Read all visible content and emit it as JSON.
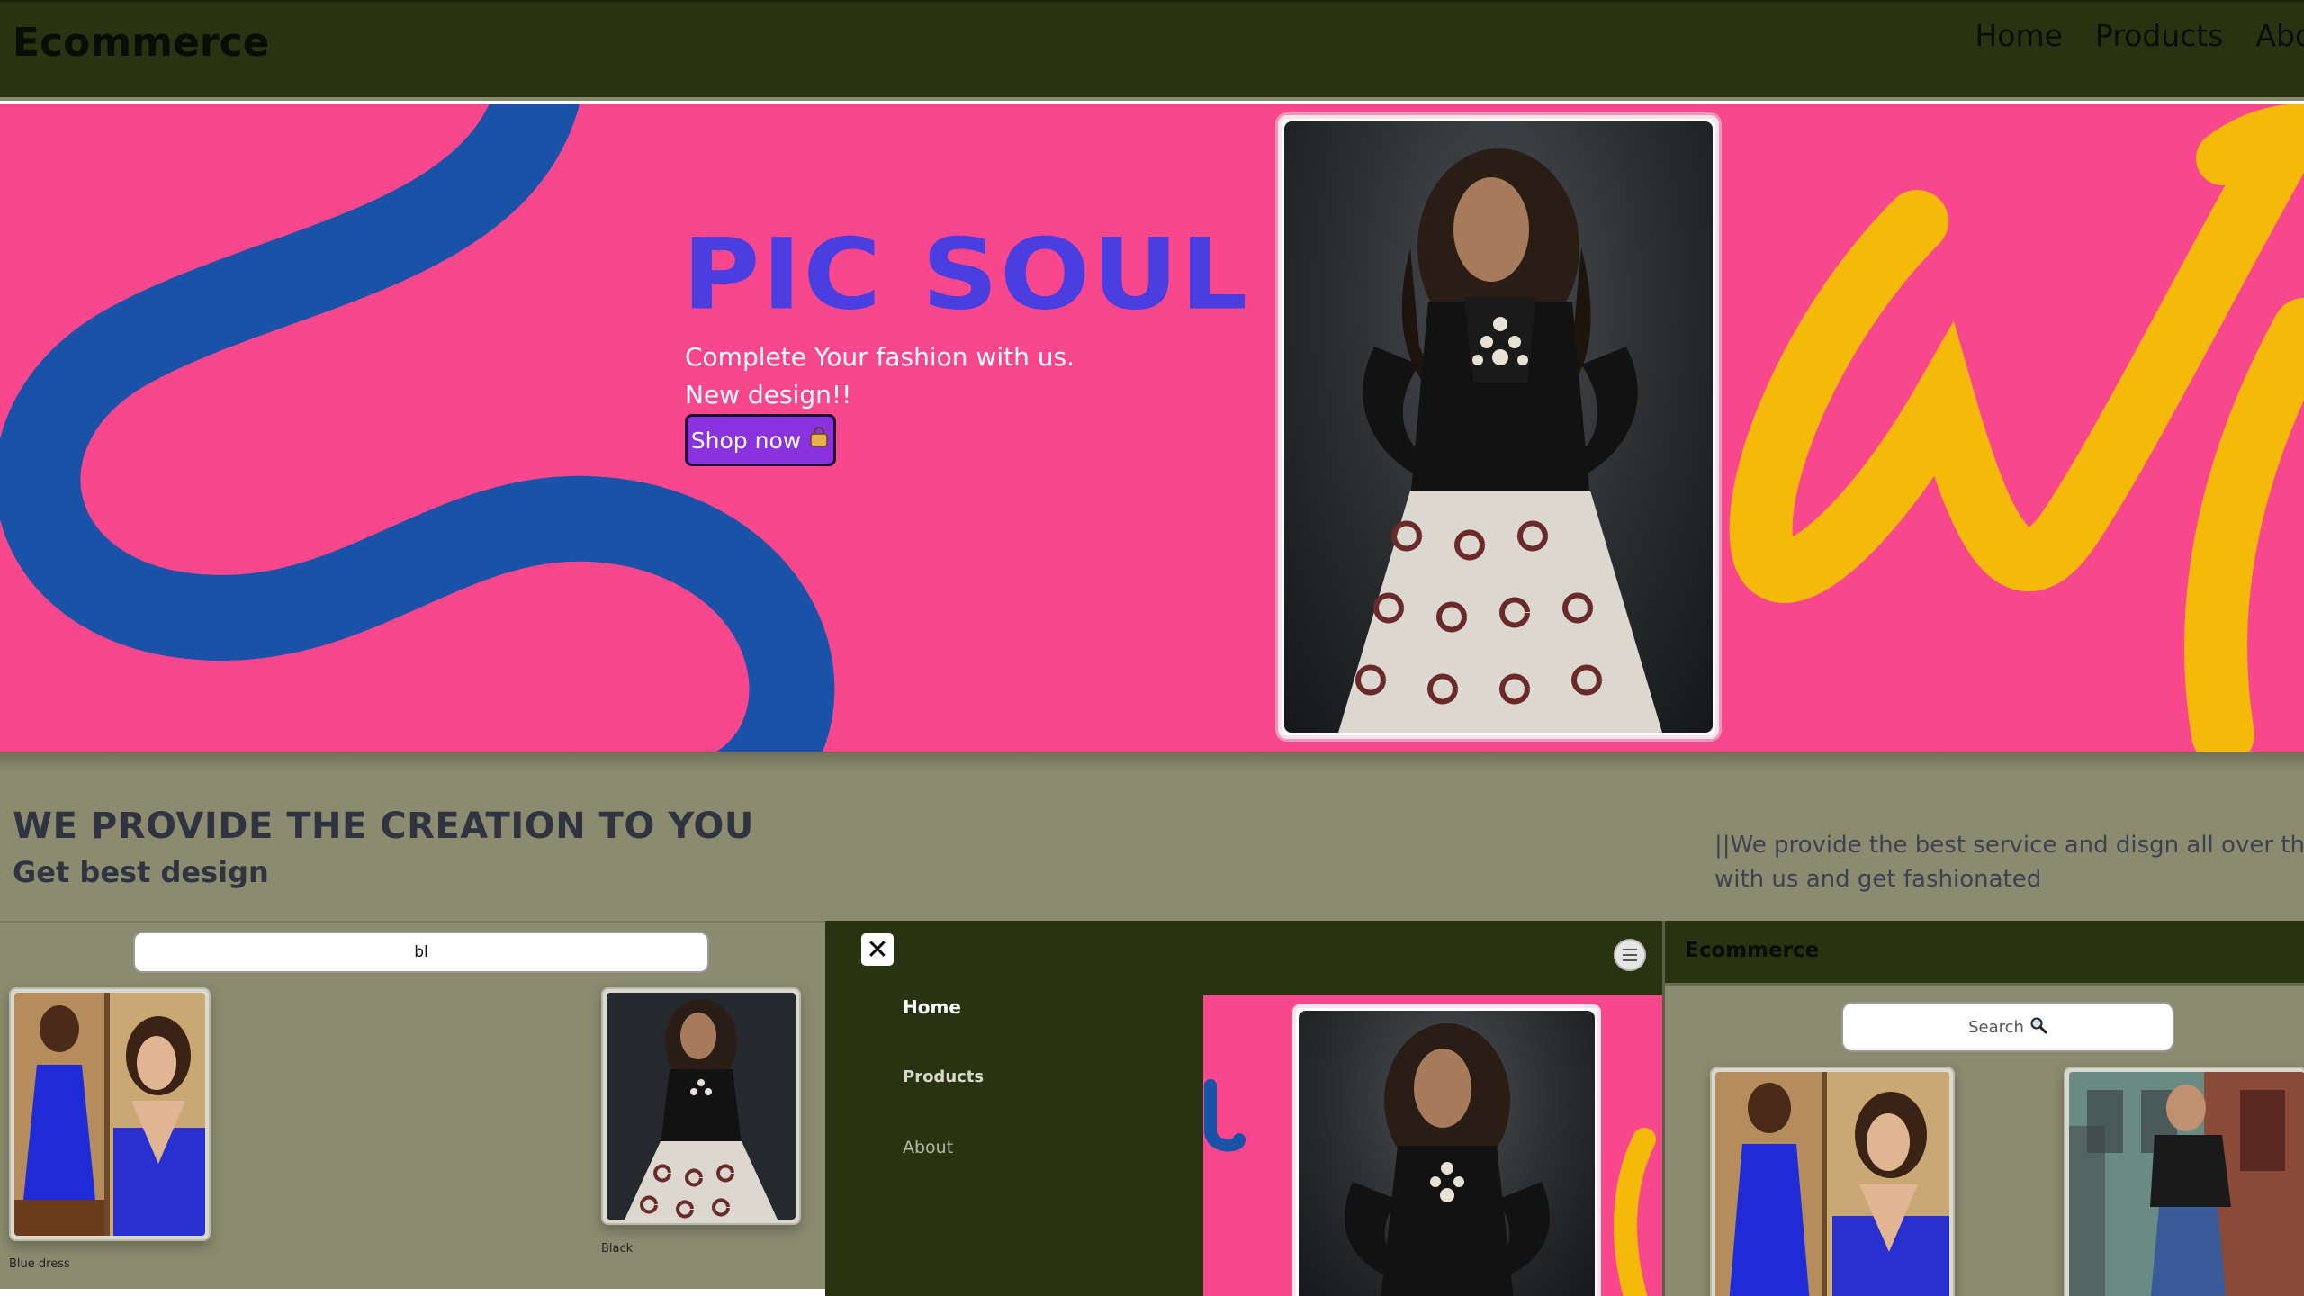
{
  "navbar": {
    "brand": "Ecommerce",
    "links": [
      "Home",
      "Products",
      "About"
    ]
  },
  "hero": {
    "title": "PIC SOUL",
    "subtitle_line1": "Complete Your fashion with us.",
    "subtitle_line2": "New design!!",
    "cta_label": "Shop now",
    "cta_icon": "shopping-bag-icon",
    "colors": {
      "background": "#f9478e",
      "blue_swirl": "#1a52a8",
      "yellow_script": "#f5b90a",
      "cta": "#8a31e0"
    }
  },
  "creation": {
    "heading": "WE PROVIDE THE CREATION TO YOU",
    "subheading": "Get best design",
    "text": "||We provide the best service and disgn all over the world. Come with us and get fashionated",
    "text_line1": "||We provide the best service and disgn all over the w",
    "text_line2": "with us and get fashionated"
  },
  "search_results": {
    "search_value": "bl",
    "items": [
      {
        "caption": "Blue dress"
      },
      {
        "caption": "Black"
      }
    ]
  },
  "mobile_menu": {
    "close_icon": "close-icon",
    "menu_icon": "hamburger-icon",
    "items": [
      "Home",
      "Products",
      "About"
    ]
  },
  "mobile_view": {
    "brand": "Ecommerce",
    "search_placeholder": "Search",
    "search_icon": "search-icon"
  }
}
